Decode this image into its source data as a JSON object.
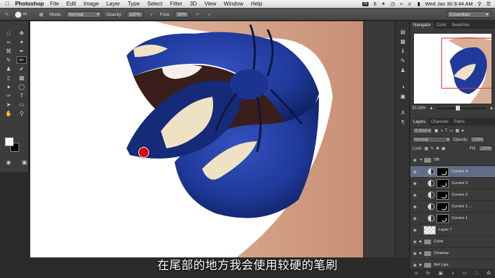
{
  "menubar": {
    "apple": "",
    "app_name": "Photoshop",
    "items": [
      "File",
      "Edit",
      "Image",
      "Layer",
      "Type",
      "Select",
      "Filter",
      "3D",
      "View",
      "Window",
      "Help"
    ],
    "status": {
      "ai_badge": "AI",
      "ai_count": "6",
      "clock": "Wed Jan 30  9:44 AM"
    }
  },
  "options": {
    "brush_size": "94",
    "mode_label": "Mode:",
    "mode_value": "Normal",
    "opacity_label": "Opacity:",
    "opacity_value": "100%",
    "flow_label": "Flow:",
    "flow_value": "30%",
    "workspace": "Essentials"
  },
  "navigator": {
    "tabs": [
      "Navigator",
      "Color",
      "Swatches"
    ],
    "zoom": "33.33%"
  },
  "layers_panel": {
    "tabs": [
      "Layers",
      "Channels",
      "Paths"
    ],
    "filter_label": "Kind",
    "blend_mode": "Normal",
    "opacity_label": "Opacity:",
    "opacity_value": "100%",
    "lock_label": "Lock:",
    "fill_label": "Fill:",
    "fill_value": "100%",
    "layers": [
      {
        "name": "DB",
        "kind": "group-open"
      },
      {
        "name": "Curves 4",
        "kind": "adjustment",
        "selected": true
      },
      {
        "name": "Curves 3",
        "kind": "adjustment"
      },
      {
        "name": "Curves 2",
        "kind": "adjustment"
      },
      {
        "name": "Curves 1 ...",
        "kind": "adjustment"
      },
      {
        "name": "Curves 1",
        "kind": "adjustment"
      },
      {
        "name": "Layer 7",
        "kind": "pixel"
      },
      {
        "name": "Color",
        "kind": "group"
      },
      {
        "name": "Cleanup",
        "kind": "group"
      },
      {
        "name": "Not Lips",
        "kind": "group"
      }
    ]
  },
  "subtitle": "在尾部的地方我会使用较硬的笔刷",
  "colors": {
    "lip_blue": "#1f3a9a",
    "cursor_red": "#d30a16",
    "selection_blue": "#5f6e86"
  }
}
